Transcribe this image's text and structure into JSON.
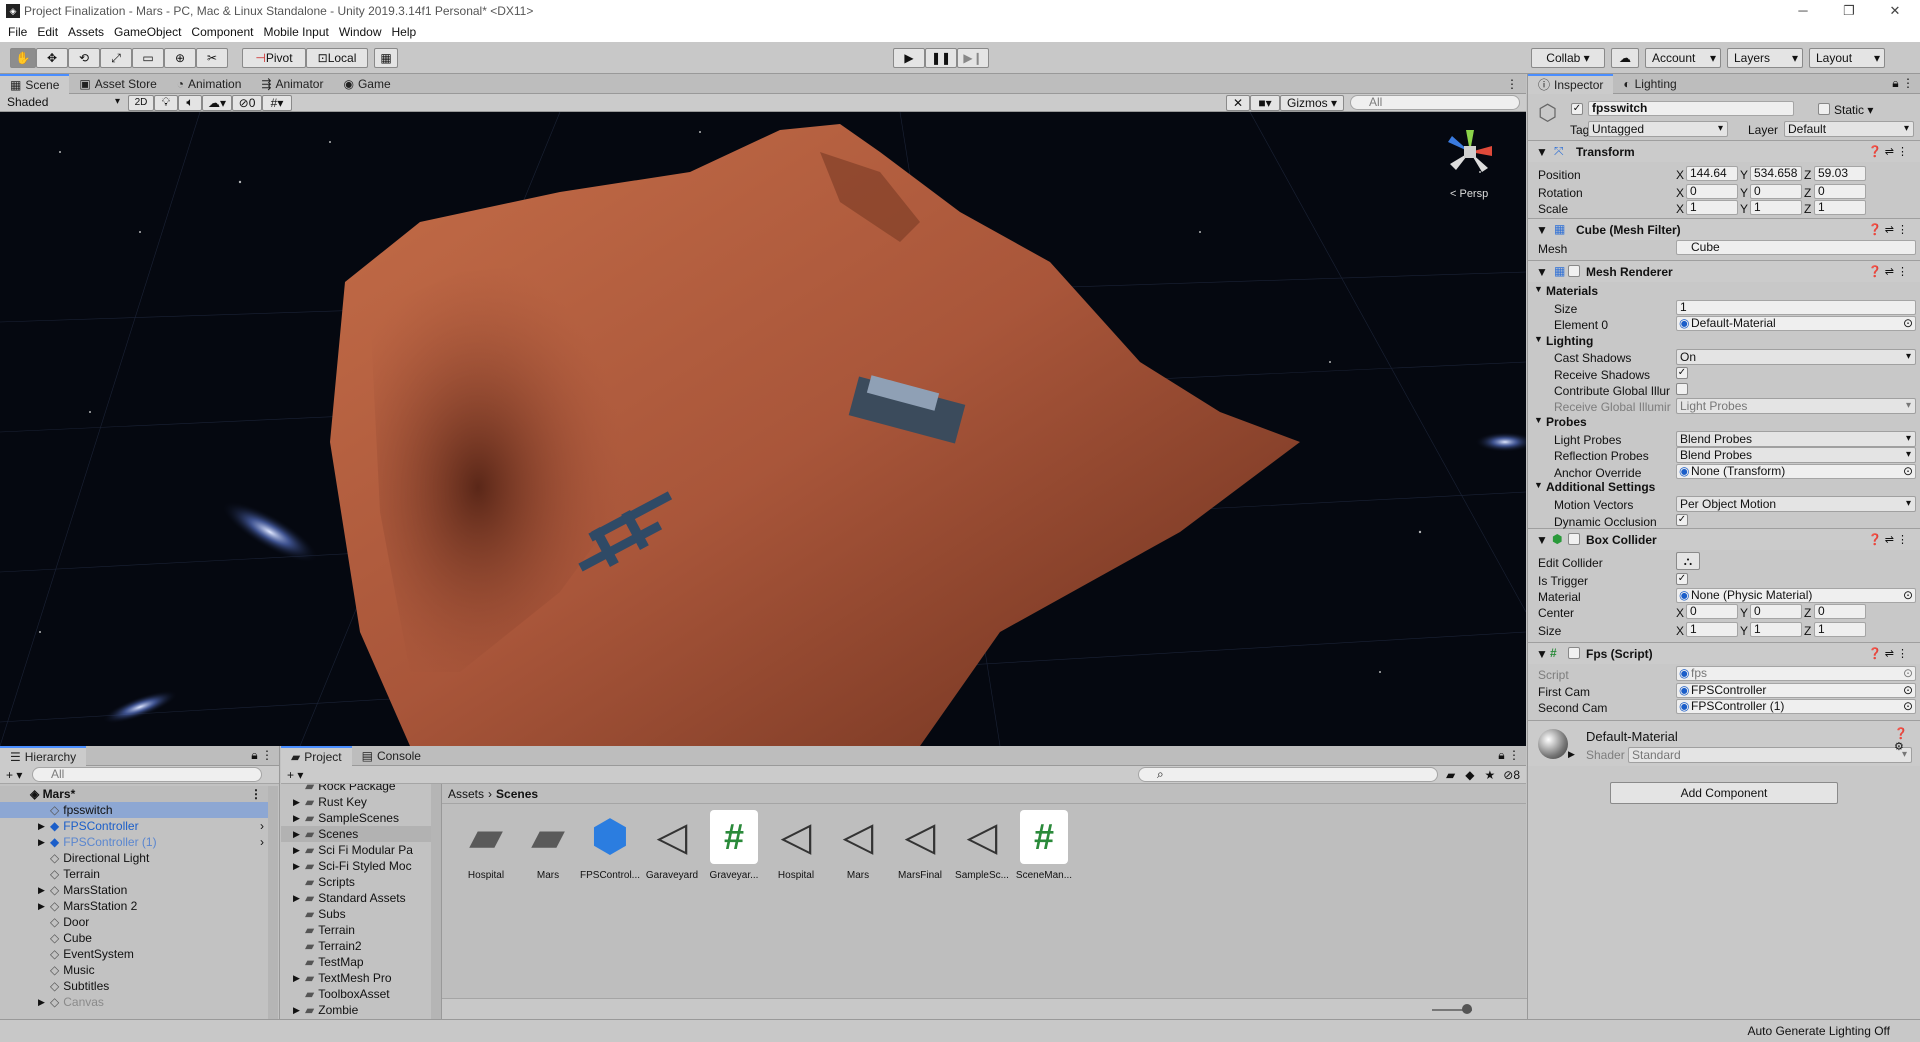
{
  "window": {
    "title": "Project Finalization - Mars - PC, Mac & Linux Standalone - Unity 2019.3.14f1 Personal* <DX11>",
    "icon": "unity-logo-icon",
    "controls": [
      "minimize",
      "maximize",
      "close"
    ]
  },
  "menu": [
    "File",
    "Edit",
    "Assets",
    "GameObject",
    "Component",
    "Mobile Input",
    "Window",
    "Help"
  ],
  "toolbar": {
    "pivot": "Pivot",
    "local": "Local",
    "collab": "Collab ▾",
    "account": "Account",
    "layers": "Layers",
    "layout": "Layout"
  },
  "scene_tabs": [
    "Scene",
    "Asset Store",
    "Animation",
    "Animator",
    "Game"
  ],
  "scene_controls": {
    "shading": "Shaded",
    "mode2d": "2D",
    "hidden_count": "0",
    "gizmos": "Gizmos",
    "search_placeholder": "All",
    "persp": "< Persp"
  },
  "hierarchy": {
    "tab": "Hierarchy",
    "search_placeholder": "All",
    "scene": "Mars*",
    "items": [
      {
        "label": "fpsswitch",
        "indent": 1,
        "arrow": false,
        "style": "selected"
      },
      {
        "label": "FPSController",
        "indent": 1,
        "arrow": true,
        "style": "prefab"
      },
      {
        "label": "FPSController (1)",
        "indent": 1,
        "arrow": true,
        "style": "prefab-dim"
      },
      {
        "label": "Directional Light",
        "indent": 1,
        "arrow": false,
        "style": ""
      },
      {
        "label": "Terrain",
        "indent": 1,
        "arrow": false,
        "style": ""
      },
      {
        "label": "MarsStation",
        "indent": 1,
        "arrow": true,
        "style": ""
      },
      {
        "label": "MarsStation 2",
        "indent": 1,
        "arrow": true,
        "style": ""
      },
      {
        "label": "Door",
        "indent": 1,
        "arrow": false,
        "style": ""
      },
      {
        "label": "Cube",
        "indent": 1,
        "arrow": false,
        "style": ""
      },
      {
        "label": "EventSystem",
        "indent": 1,
        "arrow": false,
        "style": ""
      },
      {
        "label": "Music",
        "indent": 1,
        "arrow": false,
        "style": ""
      },
      {
        "label": "Subtitles",
        "indent": 1,
        "arrow": false,
        "style": ""
      },
      {
        "label": "Canvas",
        "indent": 1,
        "arrow": true,
        "style": "dim"
      }
    ]
  },
  "project": {
    "tabs": [
      "Project",
      "Console"
    ],
    "hidden_count": "8",
    "folders": [
      {
        "label": "Rock Package",
        "arrow": false
      },
      {
        "label": "Rust Key",
        "arrow": true
      },
      {
        "label": "SampleScenes",
        "arrow": true
      },
      {
        "label": "Scenes",
        "arrow": true
      },
      {
        "label": "Sci Fi Modular Pa",
        "arrow": true
      },
      {
        "label": "Sci-Fi Styled Moc",
        "arrow": true
      },
      {
        "label": "Scripts",
        "arrow": false
      },
      {
        "label": "Standard Assets",
        "arrow": true
      },
      {
        "label": "Subs",
        "arrow": false
      },
      {
        "label": "Terrain",
        "arrow": false
      },
      {
        "label": "Terrain2",
        "arrow": false
      },
      {
        "label": "TestMap",
        "arrow": false
      },
      {
        "label": "TextMesh Pro",
        "arrow": true
      },
      {
        "label": "ToolboxAsset",
        "arrow": false
      },
      {
        "label": "Zombie",
        "arrow": true
      }
    ],
    "breadcrumb": [
      "Assets",
      "Scenes"
    ],
    "assets": [
      {
        "label": "Hospital",
        "kind": "folder"
      },
      {
        "label": "Mars",
        "kind": "folder"
      },
      {
        "label": "FPSControl...",
        "kind": "prefab"
      },
      {
        "label": "Garaveyard",
        "kind": "scene"
      },
      {
        "label": "Graveyar...",
        "kind": "script"
      },
      {
        "label": "Hospital",
        "kind": "scene"
      },
      {
        "label": "Mars",
        "kind": "scene"
      },
      {
        "label": "MarsFinal",
        "kind": "scene"
      },
      {
        "label": "SampleSc...",
        "kind": "scene"
      },
      {
        "label": "SceneMan...",
        "kind": "script"
      }
    ]
  },
  "inspector": {
    "tabs": [
      "Inspector",
      "Lighting"
    ],
    "object_name": "fpsswitch",
    "static": "Static",
    "tag_label": "Tag",
    "tag": "Untagged",
    "layer_label": "Layer",
    "layer": "Default",
    "transform": {
      "title": "Transform",
      "position_label": "Position",
      "rotation_label": "Rotation",
      "scale_label": "Scale",
      "pos": [
        "144.64",
        "534.658",
        "59.03"
      ],
      "rot": [
        "0",
        "0",
        "0"
      ],
      "scale": [
        "1",
        "1",
        "1"
      ]
    },
    "mesh_filter": {
      "title": "Cube (Mesh Filter)",
      "mesh_label": "Mesh",
      "mesh": "Cube"
    },
    "mesh_renderer": {
      "title": "Mesh Renderer",
      "materials": "Materials",
      "size_label": "Size",
      "size": "1",
      "element0_label": "Element 0",
      "element0": "Default-Material",
      "lighting": "Lighting",
      "cast_shadows_label": "Cast Shadows",
      "cast_shadows": "On",
      "receive_shadows_label": "Receive Shadows",
      "contribute_gi_label": "Contribute Global Illur",
      "receive_gi_label": "Receive Global Illumir",
      "receive_gi": "Light Probes",
      "probes": "Probes",
      "light_probes_label": "Light Probes",
      "light_probes": "Blend Probes",
      "reflection_probes_label": "Reflection Probes",
      "reflection_probes": "Blend Probes",
      "anchor_label": "Anchor Override",
      "anchor": "None (Transform)",
      "additional": "Additional Settings",
      "motion_vectors_label": "Motion Vectors",
      "motion_vectors": "Per Object Motion",
      "dynamic_occlusion_label": "Dynamic Occlusion"
    },
    "box_collider": {
      "title": "Box Collider",
      "edit_label": "Edit Collider",
      "trigger_label": "Is Trigger",
      "material_label": "Material",
      "material": "None (Physic Material)",
      "center_label": "Center",
      "center": [
        "0",
        "0",
        "0"
      ],
      "size_label": "Size",
      "size": [
        "1",
        "1",
        "1"
      ]
    },
    "fps_script": {
      "title": "Fps (Script)",
      "script_label": "Script",
      "script": "fps",
      "first_label": "First Cam",
      "first": "FPSController",
      "second_label": "Second Cam",
      "second": "FPSController (1)"
    },
    "material": {
      "name": "Default-Material",
      "shader_label": "Shader",
      "shader": "Standard"
    },
    "add_component": "Add Component"
  },
  "status": {
    "text": "Auto Generate Lighting Off"
  },
  "colors": {
    "accent": "#4a8eff",
    "selection": "#8da7d3",
    "terrain": "#b45f3c",
    "space": "#050810",
    "prefab_blue": "#1b5ec9"
  }
}
